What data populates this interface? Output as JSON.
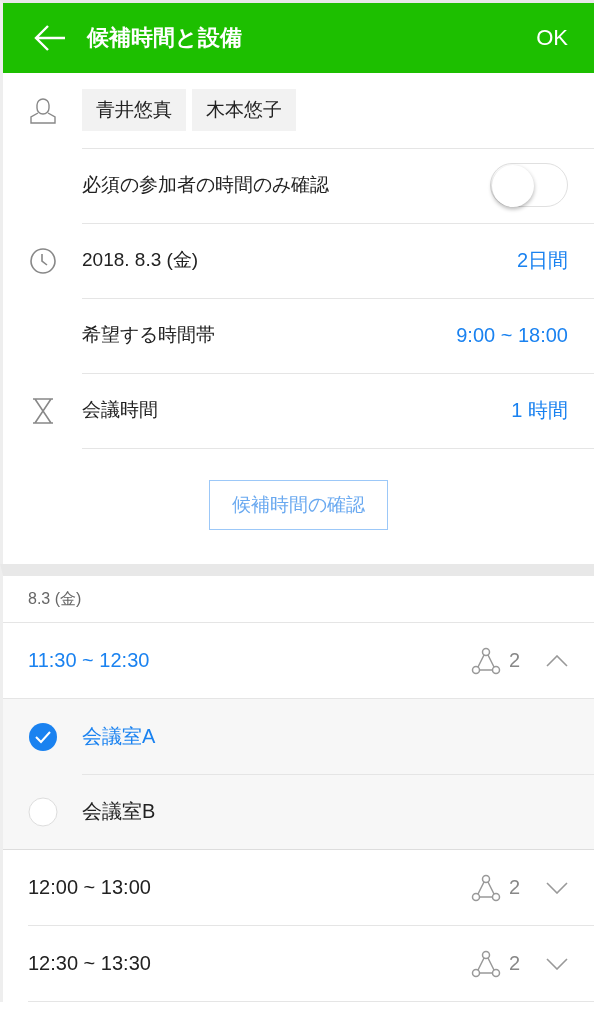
{
  "header": {
    "title": "候補時間と設備",
    "ok": "OK"
  },
  "participants": [
    "青井悠真",
    "木本悠子"
  ],
  "required_only": {
    "label": "必須の参加者の時間のみ確認",
    "on": false
  },
  "date": {
    "value": "2018. 8.3 (金)",
    "duration": "2日間"
  },
  "preferred_time": {
    "label": "希望する時間帯",
    "value": "9:00 ~ 18:00"
  },
  "meeting_length": {
    "label": "会議時間",
    "value": "1 時間"
  },
  "check_button": "候補時間の確認",
  "day_label": "8.3 (金)",
  "slots": [
    {
      "time": "11:30 ~ 12:30",
      "count": "2",
      "expanded": true,
      "rooms": [
        {
          "name": "会議室A",
          "selected": true
        },
        {
          "name": "会議室B",
          "selected": false
        }
      ]
    },
    {
      "time": "12:00 ~ 13:00",
      "count": "2",
      "expanded": false
    },
    {
      "time": "12:30 ~ 13:30",
      "count": "2",
      "expanded": false
    }
  ]
}
